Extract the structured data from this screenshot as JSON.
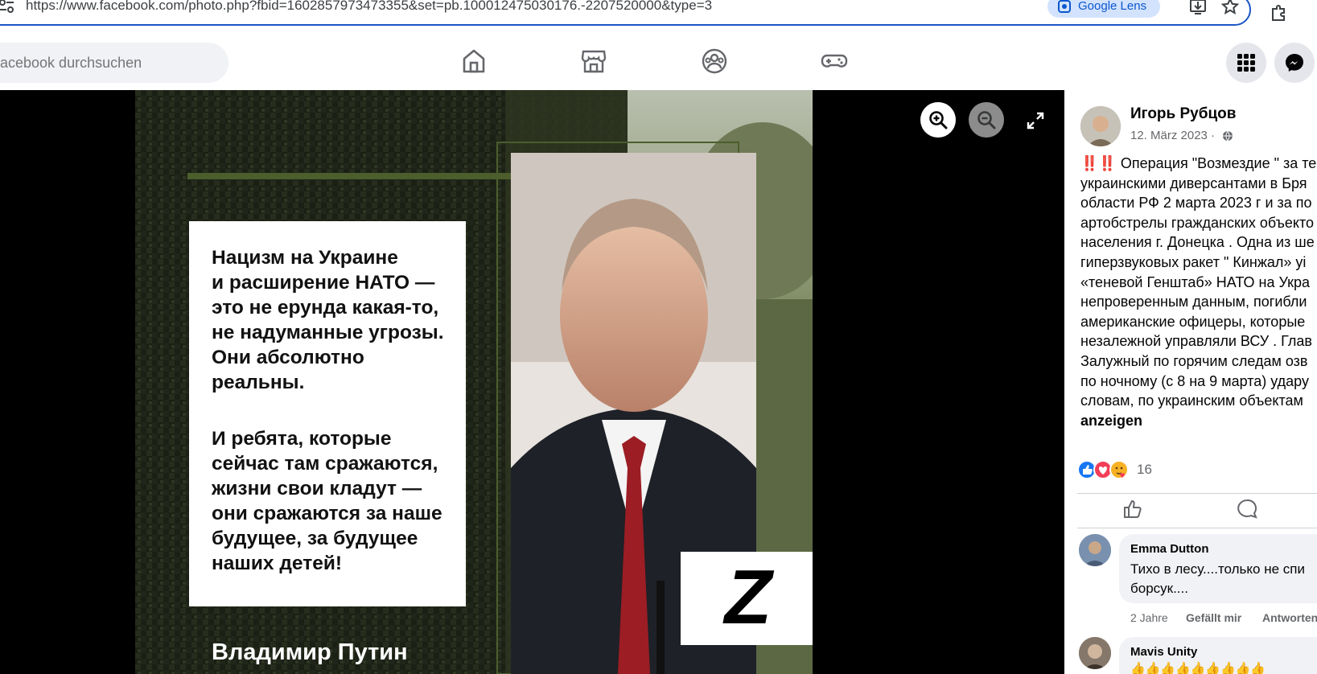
{
  "browser": {
    "url": "https://www.facebook.com/photo.php?fbid=1602857973473355&set=pb.100012475030176.-2207520000&type=3",
    "lens_label": "Google Lens"
  },
  "nav": {
    "search_placeholder": "acebook durchsuchen"
  },
  "poster": {
    "quote_para1": [
      "Нацизм на Украине",
      "и расширение НАТО —",
      "это не ерунда какая-то,",
      "не надуманные угрозы.",
      "Они абсолютно",
      "реальны."
    ],
    "quote_para2": [
      "И ребята, которые",
      "сейчас там сражаются,",
      "жизни свои кладут —",
      "они сражаются за наше",
      "будущее, за будущее",
      "наших детей!"
    ],
    "author": "Владимир Путин",
    "z_letter": "Z"
  },
  "post": {
    "author": "Игорь Рубцов",
    "date": "12. März 2023 ·",
    "text_lines": [
      "‼️‼️ Операция \"Возмездие \" за те",
      "украинскими диверсантами в Бря",
      "области РФ 2 марта 2023 г и за по",
      "артобстрелы гражданских объекто",
      "населения г. Донецка . Одна из ше",
      "гиперзвуковых ракет \" Кинжал» уі",
      "«теневой Генштаб» НАТО на Укра",
      "непроверенным данным, погибли",
      "американские офицеры, которые",
      "незалежной управляли ВСУ . Глав",
      "Залужный по горячим следам озв",
      "по ночному (с 8 на 9 марта) удару",
      "словам, по украинским объектам"
    ],
    "see_more": "anzeigen",
    "reaction_count": "16"
  },
  "comments": [
    {
      "author": "Emma Dutton",
      "text_lines": [
        "Тихо в лесу....только не спи",
        "борсук...."
      ],
      "age": "2 Jahre",
      "like": "Gefällt mir",
      "reply": "Antworten"
    },
    {
      "author": "Mavis Unity",
      "text_lines": [
        "👍👍👍👍👍👍👍👍👍"
      ]
    }
  ],
  "colors": {
    "fb_blue": "#1877f2",
    "lens_bg": "#d3e3fd",
    "poster_green": "#4b5e2c"
  },
  "icons": {
    "tune": "tune-icon",
    "lens": "google-lens-icon",
    "save": "download-icon",
    "star": "star-icon",
    "extension": "extension-icon",
    "home": "home-icon",
    "marketplace": "marketplace-icon",
    "groups": "groups-icon",
    "gaming": "gaming-icon",
    "menu": "menu-grid-icon",
    "messenger": "messenger-icon",
    "zoom_in": "zoom-in-icon",
    "zoom_out": "zoom-out-icon",
    "fullscreen": "fullscreen-icon",
    "like": "like-icon",
    "comment": "comment-icon",
    "globe": "globe-icon"
  }
}
